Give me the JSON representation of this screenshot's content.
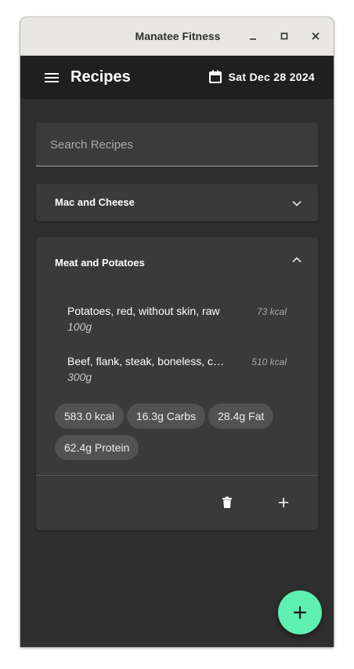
{
  "window": {
    "title": "Manatee Fitness",
    "controls": {
      "minimize_icon": "minimize-icon",
      "maximize_icon": "maximize-icon",
      "close_icon": "close-icon"
    }
  },
  "appbar": {
    "menu_icon": "hamburger-menu-icon",
    "title": "Recipes",
    "calendar_icon": "calendar-icon",
    "date": "Sat Dec 28 2024"
  },
  "search": {
    "placeholder": "Search Recipes",
    "value": ""
  },
  "recipes": [
    {
      "name": "Mac and Cheese",
      "expanded": false,
      "toggle_icon": "chevron-down-icon"
    },
    {
      "name": "Meat and Potatoes",
      "expanded": true,
      "toggle_icon": "chevron-up-icon",
      "ingredients": [
        {
          "name": "Potatoes, red, without skin, raw",
          "quantity": "100g",
          "kcal": "73 kcal"
        },
        {
          "name": "Beef, flank, steak, boneless, c…",
          "quantity": "300g",
          "kcal": "510 kcal"
        }
      ],
      "totals": {
        "kcal": "583.0 kcal",
        "carbs": "16.3g Carbs",
        "fat": "28.4g Fat",
        "protein": "62.4g Protein"
      },
      "actions": {
        "delete_icon": "trash-icon",
        "add_icon": "plus-icon"
      }
    }
  ],
  "fab": {
    "icon": "plus-icon"
  },
  "colors": {
    "background": "#2e2e2e",
    "appbar": "#1f1f1f",
    "panel": "#3a3a3a",
    "chip": "#525252",
    "fab_accent": "#5ef0b0",
    "titlebar": "#e9e7e4"
  }
}
